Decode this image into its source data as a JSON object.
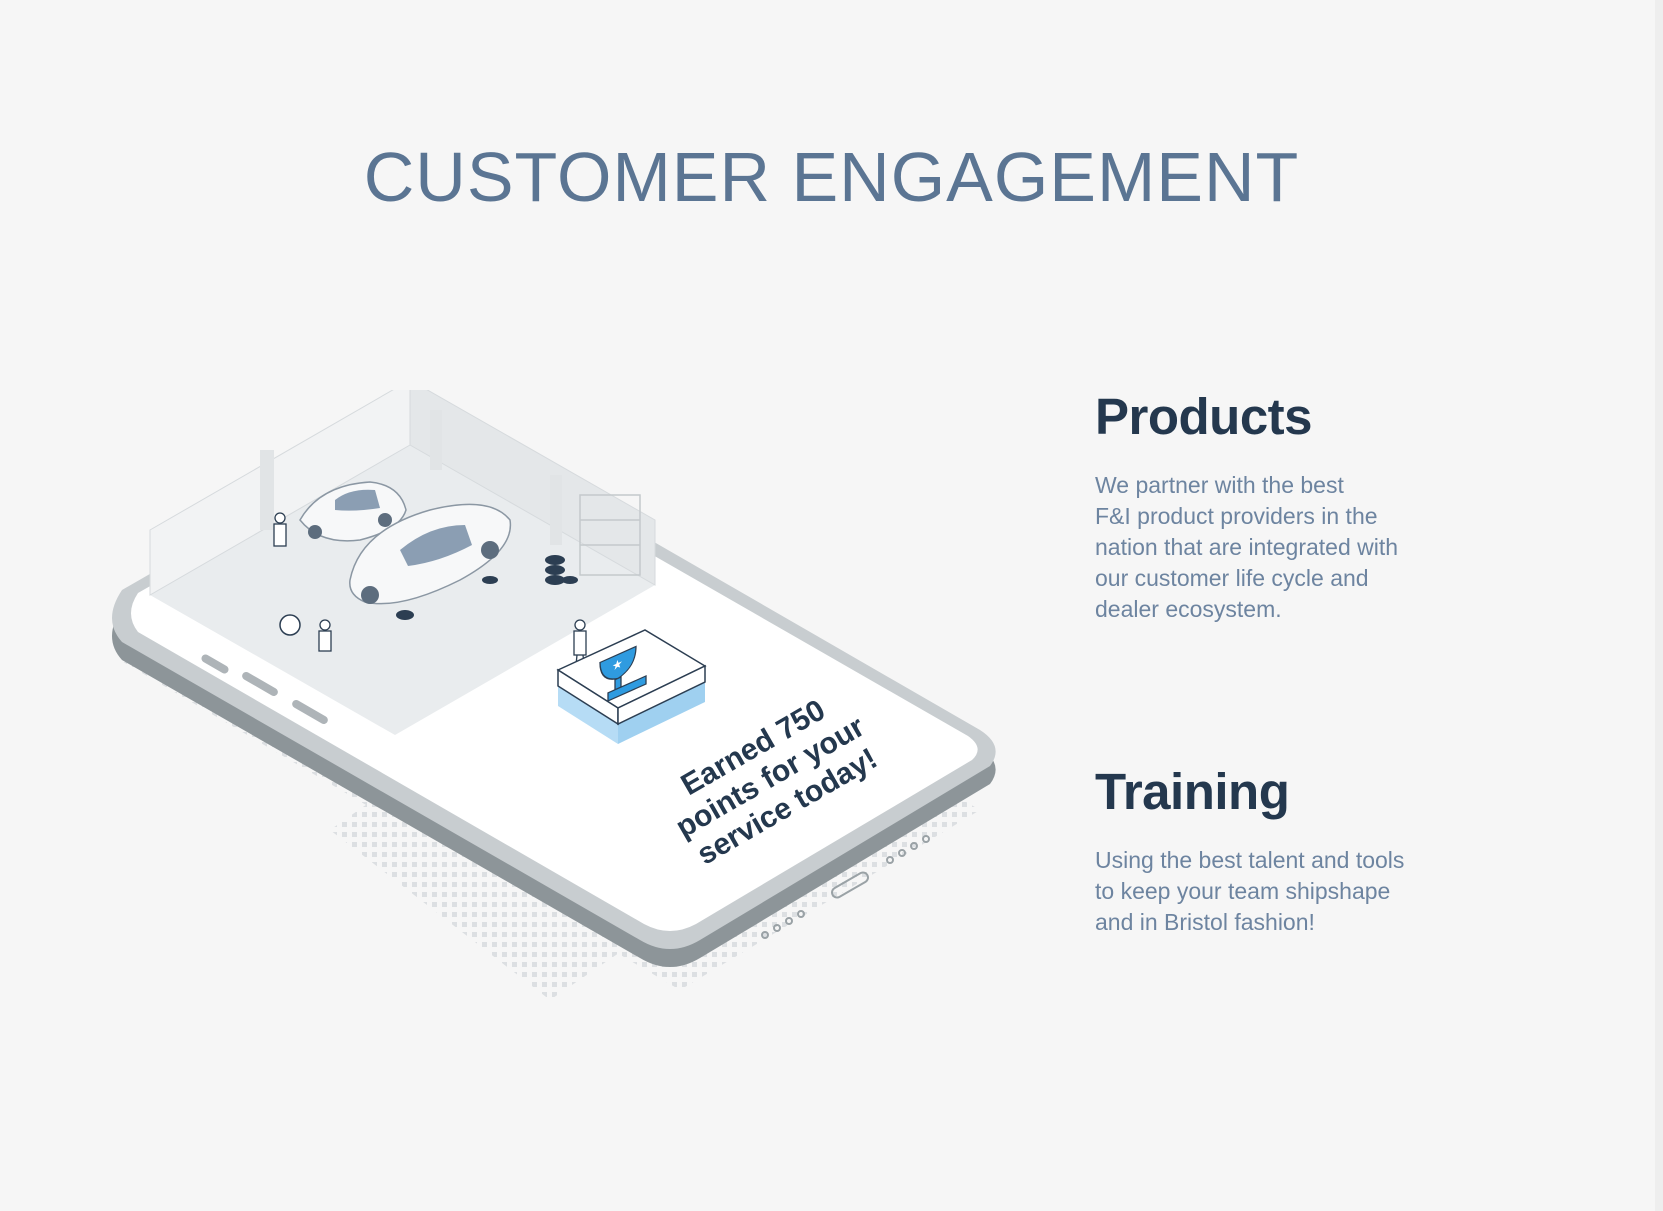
{
  "page_title": "CUSTOMER ENGAGEMENT",
  "illustration": {
    "caption_line1": "Earned 750",
    "caption_line2": "points for your",
    "caption_line3": "service today!",
    "accent_color": "#2f9be0",
    "dark_color": "#24384e",
    "icon": "trophy-icon"
  },
  "features": {
    "products": {
      "title": "Products",
      "description": "We partner with the best\nF&I product providers in the\nnation that are integrated with\nour customer life cycle and\ndealer ecosystem."
    },
    "training": {
      "title": "Training",
      "description": "Using the best talent and tools\nto keep your team shipshape\nand in Bristol fashion!"
    }
  }
}
